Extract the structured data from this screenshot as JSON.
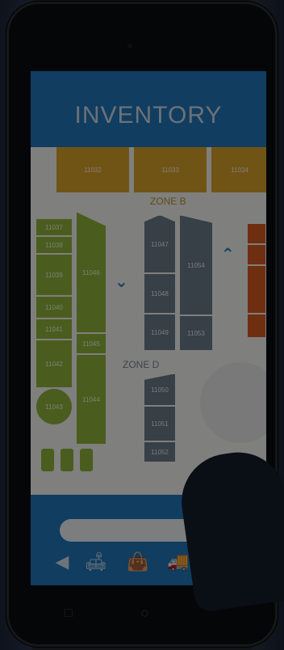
{
  "app": {
    "title": "INVENTORY"
  },
  "map": {
    "top_row": [
      "11032",
      "11033",
      "11034"
    ],
    "zone_b": "ZONE B",
    "zone_d": "ZONE D",
    "left_column": [
      "11037",
      "11038",
      "11039",
      "11040",
      "11041",
      "11042",
      "11043"
    ],
    "green_column": [
      "11046",
      "11045",
      "11044"
    ],
    "center_column_a": [
      "11047",
      "11048",
      "11049"
    ],
    "center_column_b": [
      "11054",
      "11053"
    ],
    "center_column_c": [
      "11050",
      "11051",
      "11052"
    ]
  },
  "search": {
    "placeholder": ""
  },
  "nav": [
    "back-triangle-icon",
    "sofa-icon",
    "shopping-bag-icon",
    "truck-icon"
  ],
  "colors": {
    "header": "#1f76b8",
    "zone_yellow": "#d6a12b",
    "zone_green": "#8fb33a",
    "zone_slate": "#6a7a88",
    "zone_orange": "#d45a22"
  }
}
